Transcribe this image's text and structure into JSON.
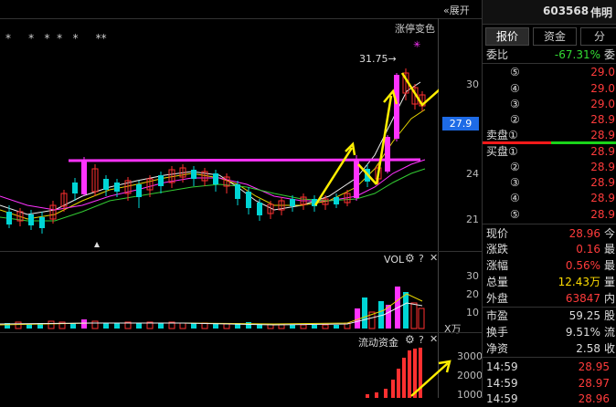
{
  "chart_area": {
    "expand_label": "展开",
    "limit_up_label": "涨停变色",
    "stars": "*     *   *  *   *     **",
    "price_high_label": "31.75→",
    "axis_labels": [
      "30",
      "27.9",
      "24",
      "21"
    ],
    "current_price_box": "27.9",
    "colors": {
      "up": "#ff3030",
      "down": "#00d5d5",
      "magenta": "#ff33ff",
      "arrow": "#ffee00"
    }
  },
  "vol_panel": {
    "label": "VOL",
    "axis_labels": [
      "30",
      "20",
      "10"
    ],
    "unit": "X万"
  },
  "flow_panel": {
    "label": "流动资金",
    "axis_labels": [
      "3000",
      "2000",
      "1000"
    ]
  },
  "stock": {
    "code": "603568",
    "name": "伟明"
  },
  "tabs": [
    "报价",
    "资金",
    "分"
  ],
  "order_book": {
    "ratio_label": "委比",
    "ratio_value": "-67.31%",
    "ratio_suffix": "委",
    "sell": [
      {
        "label": "⑤",
        "price": "29.0"
      },
      {
        "label": "④",
        "price": "29.0"
      },
      {
        "label": "③",
        "price": "29.0"
      },
      {
        "label": "②",
        "price": "28.9"
      },
      {
        "label": "卖盘①",
        "price": "28.9"
      }
    ],
    "buy": [
      {
        "label": "买盘①",
        "price": "28.9"
      },
      {
        "label": "②",
        "price": "28.9"
      },
      {
        "label": "③",
        "price": "28.9"
      },
      {
        "label": "④",
        "price": "28.9"
      },
      {
        "label": "⑤",
        "price": "28.9"
      }
    ]
  },
  "quote": [
    {
      "label": "现价",
      "value": "28.96",
      "suffix": "今",
      "color": "red"
    },
    {
      "label": "涨跌",
      "value": "0.16",
      "suffix": "最",
      "color": "red"
    },
    {
      "label": "涨幅",
      "value": "0.56%",
      "suffix": "最",
      "color": "red"
    },
    {
      "label": "总量",
      "value": "12.43万",
      "suffix": "量",
      "color": "yellow"
    },
    {
      "label": "外盘",
      "value": "63847",
      "suffix": "内",
      "color": "red"
    },
    {
      "label": "市盈",
      "value": "59.25",
      "suffix": "股",
      "color": "white"
    },
    {
      "label": "换手",
      "value": "9.51%",
      "suffix": "流",
      "color": "white"
    },
    {
      "label": "净资",
      "value": "2.58",
      "suffix": "收",
      "color": "white"
    }
  ],
  "ticks": [
    {
      "time": "14:59",
      "price": "28.95"
    },
    {
      "time": "14:59",
      "price": "28.97"
    },
    {
      "time": "14:59",
      "price": "28.96"
    }
  ]
}
